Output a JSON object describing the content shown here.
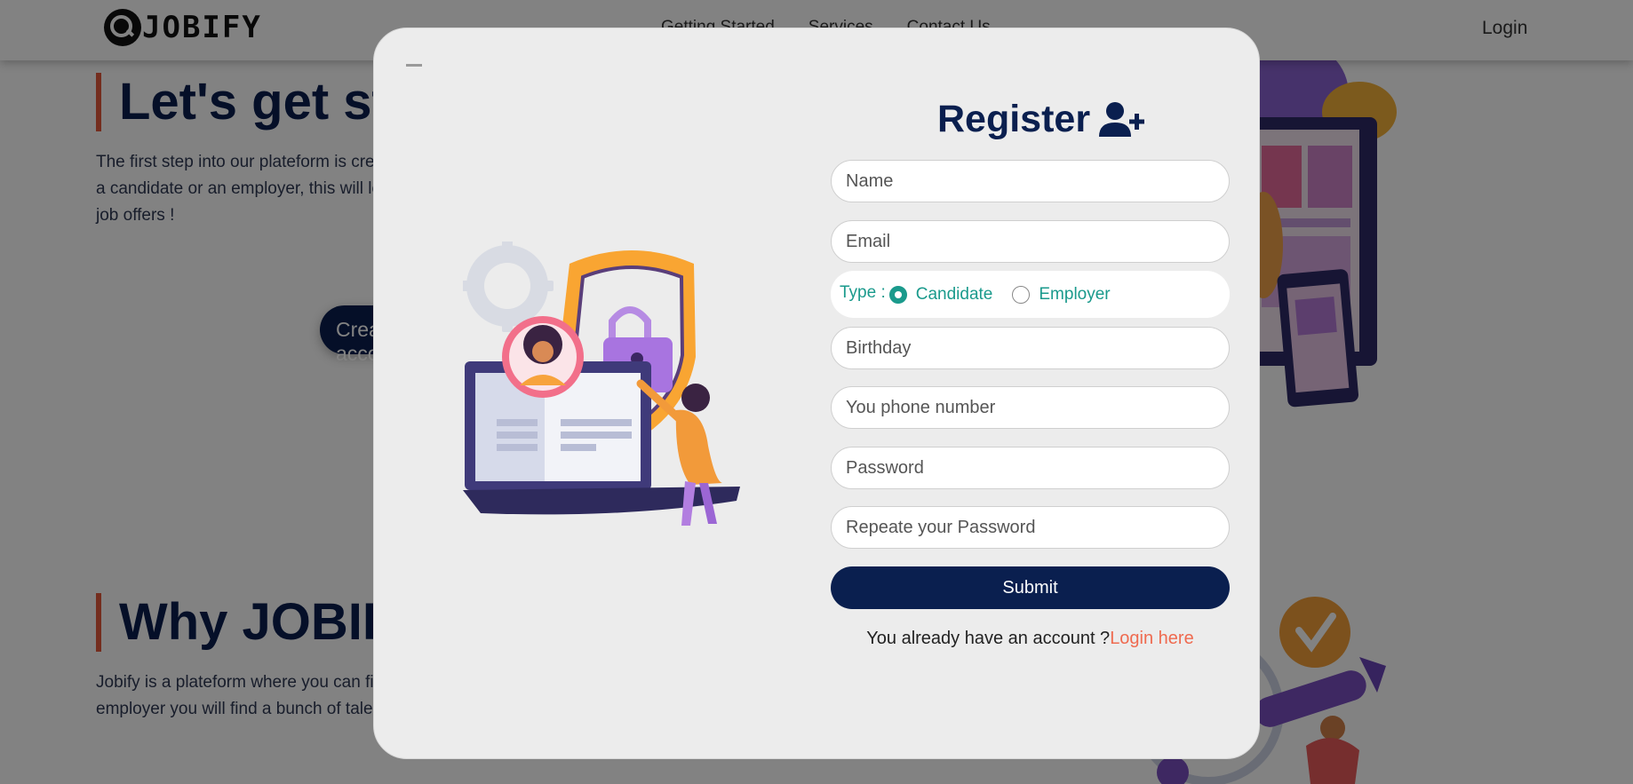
{
  "navbar": {
    "logo_text": "JOBIFY",
    "links": [
      "Getting Started",
      "Services",
      "Contact Us"
    ],
    "login_label": "Login"
  },
  "hero": {
    "title": "Let's get started",
    "text": "The first step into our plateform is creating an account, whether you are a candidate or an employer, this will let you find the best profiles and job offers !",
    "cta_label": "Create account"
  },
  "why": {
    "title": "Why JOBIFY ?",
    "text": "Jobify is a plateform where you can find the best job offers, as an employer you will find a bunch of talented employees."
  },
  "modal": {
    "minimize_icon": "minus-icon",
    "title": "Register",
    "title_icon": "user-plus-icon",
    "fields": {
      "name_placeholder": "Name",
      "email_placeholder": "Email",
      "birthday_placeholder": "Birthday",
      "phone_placeholder": "You phone number",
      "password_placeholder": "Password",
      "repeat_password_placeholder": "Repeate your Password"
    },
    "type": {
      "label": "Type :",
      "options": [
        "Candidate",
        "Employer"
      ],
      "selected": "Candidate"
    },
    "submit_label": "Submit",
    "account_text": "You already have an account ?",
    "login_link": "Login here"
  },
  "colors": {
    "brand_navy": "#0a1f4f",
    "accent_teal": "#1a9a8c",
    "link_coral": "#ef6a4f",
    "title_border": "#e3583c"
  }
}
